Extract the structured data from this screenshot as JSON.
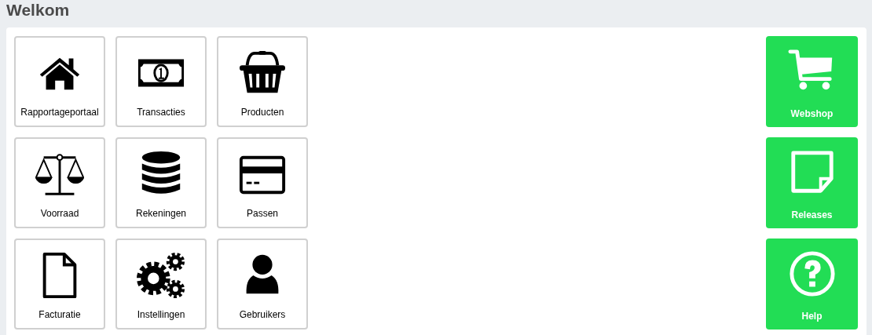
{
  "title": "Welkom",
  "tiles": [
    {
      "label": "Rapportageportaal"
    },
    {
      "label": "Transacties"
    },
    {
      "label": "Producten"
    },
    {
      "label": "Voorraad"
    },
    {
      "label": "Rekeningen"
    },
    {
      "label": "Passen"
    },
    {
      "label": "Facturatie"
    },
    {
      "label": "Instellingen"
    },
    {
      "label": "Gebruikers"
    }
  ],
  "shortcuts": [
    {
      "label": "Webshop"
    },
    {
      "label": "Releases"
    },
    {
      "label": "Help"
    }
  ]
}
